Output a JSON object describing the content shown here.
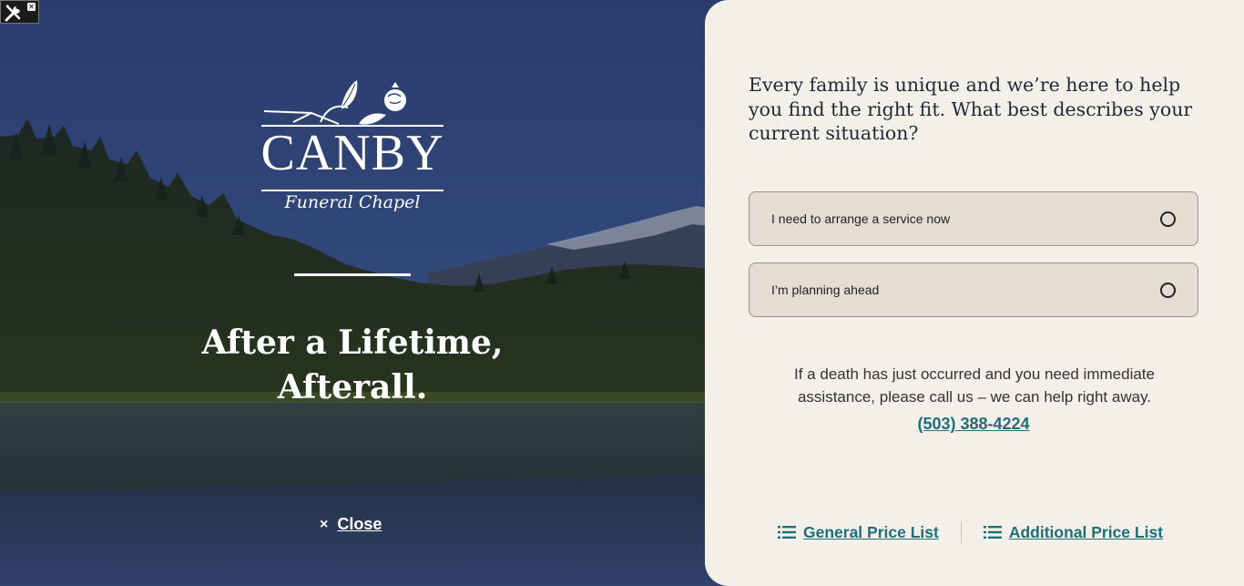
{
  "hero": {
    "brand_name": "CANBY",
    "brand_subtitle": "Funeral Chapel",
    "title_line1": "After a Lifetime,",
    "title_line2": "Afterall.",
    "close_label": "Close",
    "close_icon": "×"
  },
  "panel": {
    "question": "Every family is unique and we’re here to help you find the right fit. What best describes your current situation?",
    "options": [
      {
        "label": "I need to arrange a service now",
        "selected": false
      },
      {
        "label": "I’m planning ahead",
        "selected": false
      }
    ],
    "notice": "If a death has just occurred and you need immediate assistance, please call us – we can help right away.",
    "phone": "(503) 388-4224",
    "links": {
      "general_price_list": "General Price List",
      "additional_price_list": "Additional Price List"
    }
  },
  "colors": {
    "accent": "#1e6f78",
    "panel_bg": "#f3efe9",
    "option_bg": "#e5ddd2",
    "heading": "#1f2a33"
  }
}
